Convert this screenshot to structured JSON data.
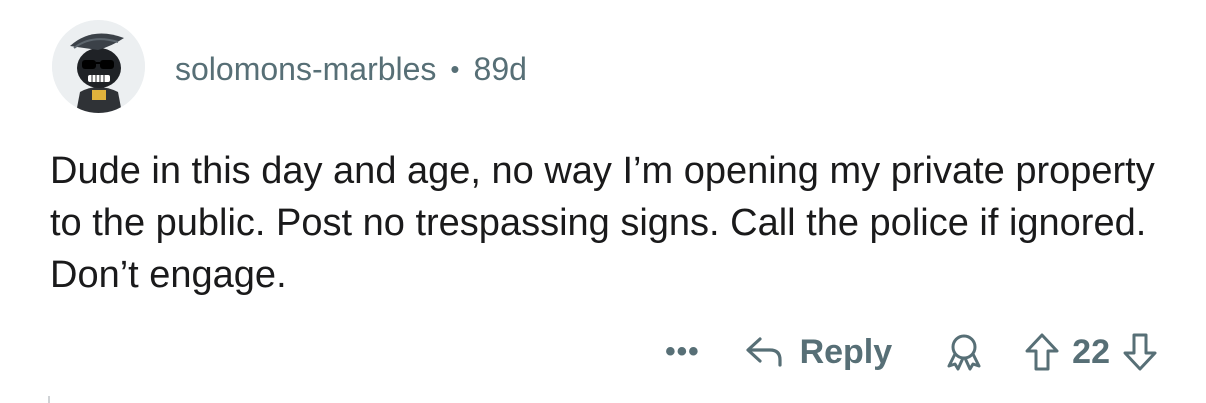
{
  "comment": {
    "username": "solomons-marbles",
    "separator": "•",
    "age": "89d",
    "text": "Dude in this day and age, no way I’m opening my private property to the public. Post no trespassing signs. Call the police if ignored. Don’t engage."
  },
  "actions": {
    "more_label": "•••",
    "reply_label": "Reply",
    "vote_count": "22"
  },
  "icons": {
    "reply": "reply-arrow-icon",
    "award": "award-icon",
    "upvote": "upvote-arrow-icon",
    "downvote": "downvote-arrow-icon",
    "avatar": "user-avatar"
  },
  "colors": {
    "meta_text": "#576f76",
    "body_text": "#1a1a1b",
    "background": "#ffffff"
  }
}
